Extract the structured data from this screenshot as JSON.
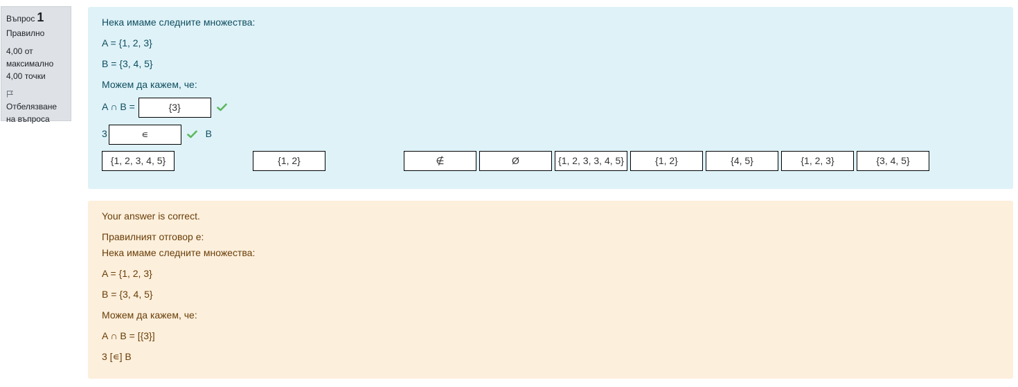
{
  "info": {
    "question_label": "Въпрос",
    "question_number": "1",
    "state": "Правилно",
    "grade": "4,00 от максимално 4,00 точки",
    "flag_label": "Отбелязване на въпроса"
  },
  "question": {
    "intro": "Нека имаме следните множества:",
    "set_a": "A = {1, 2, 3}",
    "set_b": "B = {3, 4, 5}",
    "prompt": "Можем да кажем, че:",
    "row1_prefix": "A ∩ B =",
    "row1_answer": "{3}",
    "row2_prefix": "3",
    "row2_answer": "∊",
    "row2_suffix": "B",
    "choices": [
      "{1, 2, 3, 4, 5}",
      "{1, 2}",
      "∉",
      "Ø",
      "{1, 2, 3, 3, 4, 5}",
      "{1, 2}",
      "{4, 5}",
      "{1, 2, 3}",
      "{3, 4, 5}"
    ]
  },
  "feedback": {
    "result": "Your answer is correct.",
    "right_answer_label": "Правилният отговор е:",
    "intro": "Нека имаме следните множества:",
    "set_a": "A = {1, 2, 3}",
    "set_b": "B = {3, 4, 5}",
    "prompt": "Можем да кажем, че:",
    "row1": "A ∩ B = [{3}]",
    "row2": "3 [∊] B"
  },
  "colors": {
    "info_bg": "#dee2e6",
    "formulation_bg": "#def2f8",
    "formulation_text": "#0f4d5f",
    "outcome_bg": "#fcefdc",
    "outcome_text": "#693d07",
    "correct_check": "#5cb85c"
  }
}
